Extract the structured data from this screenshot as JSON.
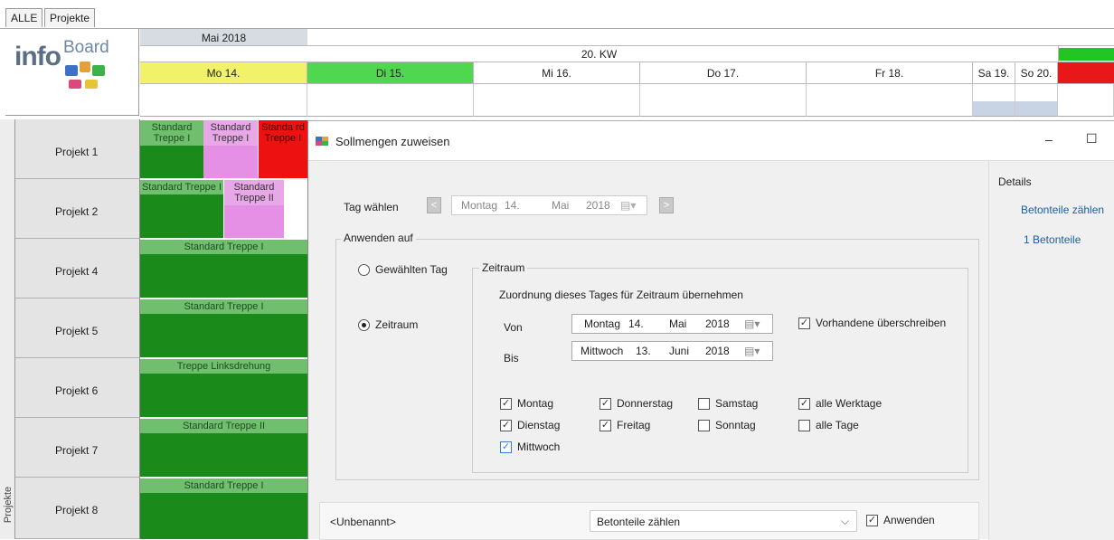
{
  "tabs": [
    "ALLE",
    "Projekte"
  ],
  "logo": {
    "info": "info",
    "board": "Board"
  },
  "calendar": {
    "month": "Mai 2018",
    "week": "20. KW",
    "days": [
      "Mo 14.",
      "Di 15.",
      "Mi 16.",
      "Do 17.",
      "Fr 18.",
      "Sa 19.",
      "So 20."
    ],
    "colors": {
      "today": "#f2f26a",
      "tomorrow": "#4fd84f",
      "status_green": "#22c522",
      "status_red": "#e81818"
    }
  },
  "sidebar_label": "Projekte",
  "projects": [
    "Projekt 1",
    "Projekt 2",
    "Projekt 4",
    "Projekt 5",
    "Projekt 6",
    "Projekt 7",
    "Projekt 8"
  ],
  "tasks": {
    "p1": [
      "Standard Treppe I",
      "Standard Treppe I",
      "Standa rd Treppe I"
    ],
    "p2": [
      "Standard Treppe I",
      "Standard Treppe II"
    ],
    "p4": "Standard Treppe I",
    "p5": "Standard Treppe I",
    "p6": "Treppe Linksdrehung",
    "p7": "Standard Treppe II",
    "p8": "Standard Treppe I"
  },
  "dialog": {
    "title": "Sollmengen zuweisen",
    "minimize": "–",
    "maximize": "☐",
    "tag_waehlen": "Tag wählen",
    "tag_date": {
      "weekday": "Montag",
      "day": "14.",
      "month": "Mai",
      "year": "2018"
    },
    "anwenden_auf": "Anwenden auf",
    "radio_tag": "Gewählten Tag",
    "radio_zeitraum": "Zeitraum",
    "zeitraum_group": "Zeitraum",
    "zuordnung": "Zuordnung dieses Tages für Zeitraum übernehmen",
    "von_label": "Von",
    "bis_label": "Bis",
    "von_date": {
      "weekday": "Montag",
      "day": "14.",
      "month": "Mai",
      "year": "2018"
    },
    "bis_date": {
      "weekday": "Mittwoch",
      "day": "13.",
      "month": "Juni",
      "year": "2018"
    },
    "ueberschreiben": "Vorhandene überschreiben",
    "weekdays": {
      "montag": "Montag",
      "dienstag": "Dienstag",
      "mittwoch": "Mittwoch",
      "donnerstag": "Donnerstag",
      "freitag": "Freitag",
      "samstag": "Samstag",
      "sonntag": "Sonntag",
      "alle_werktage": "alle Werktage",
      "alle_tage": "alle Tage"
    },
    "details": "Details",
    "details_link1": "Betonteile zählen",
    "details_link2": "1 Betonteile",
    "bottom_name": "<Unbenannt>",
    "bottom_select": "Betonteile zählen",
    "anwenden": "Anwenden"
  }
}
